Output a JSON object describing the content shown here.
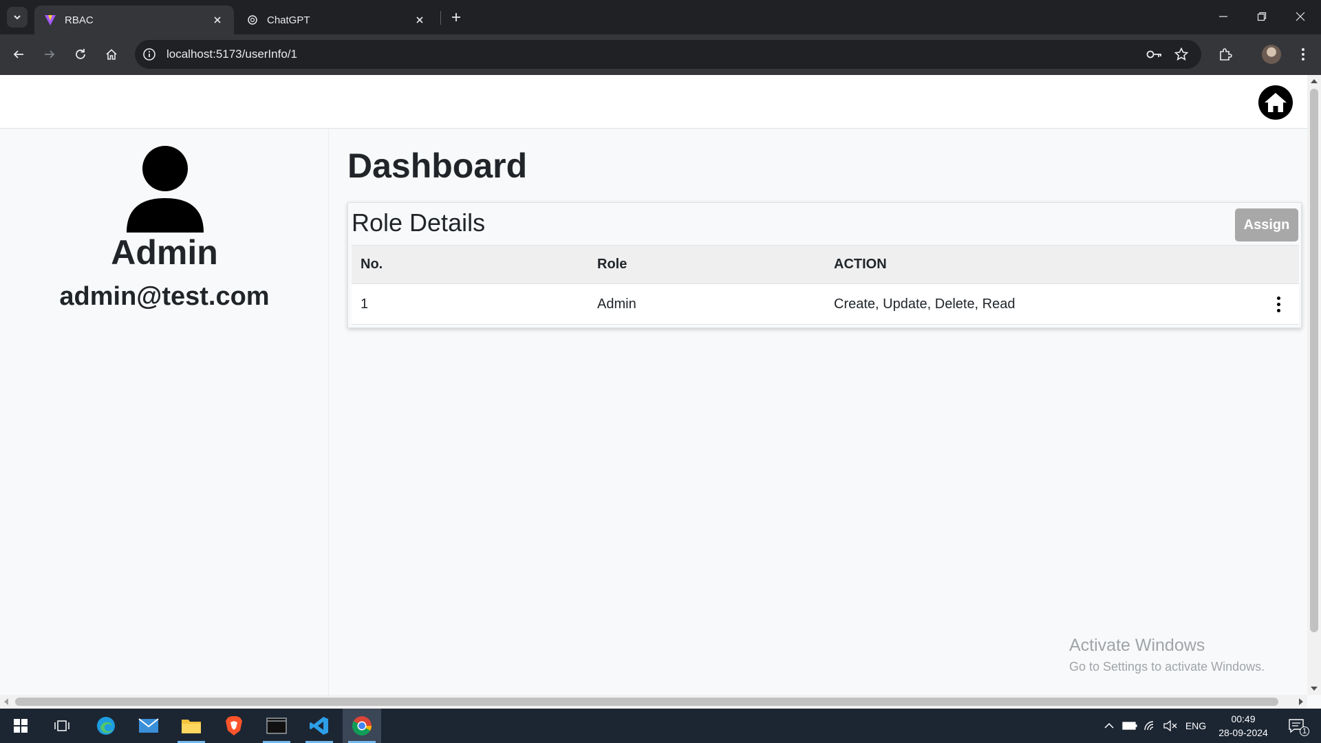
{
  "browser": {
    "tabs": [
      {
        "title": "RBAC",
        "active": true
      },
      {
        "title": "ChatGPT",
        "active": false
      }
    ],
    "url": "localhost:5173/userInfo/1"
  },
  "sidebar": {
    "user_name": "Admin",
    "user_email": "admin@test.com"
  },
  "main": {
    "title": "Dashboard",
    "card_title": "Role Details",
    "assign_label": "Assign",
    "table": {
      "headers": [
        "No.",
        "Role",
        "ACTION"
      ],
      "rows": [
        {
          "no": "1",
          "role": "Admin",
          "action": "Create, Update, Delete, Read"
        }
      ]
    }
  },
  "watermark": {
    "line1": "Activate Windows",
    "line2": "Go to Settings to activate Windows."
  },
  "taskbar": {
    "apps": [
      "start",
      "task-view",
      "edge",
      "mail",
      "file-explorer",
      "brave",
      "terminal",
      "vscode",
      "chrome"
    ],
    "tray_lang": "ENG",
    "time": "00:49",
    "date": "28-09-2024",
    "notification_count": "1"
  },
  "colors": {
    "browser_dark": "#202124",
    "browser_toolbar": "#35363a",
    "page_bg": "#f8f9fa",
    "assign_button": "#a8a8a8",
    "taskbar": "#1c2633"
  }
}
